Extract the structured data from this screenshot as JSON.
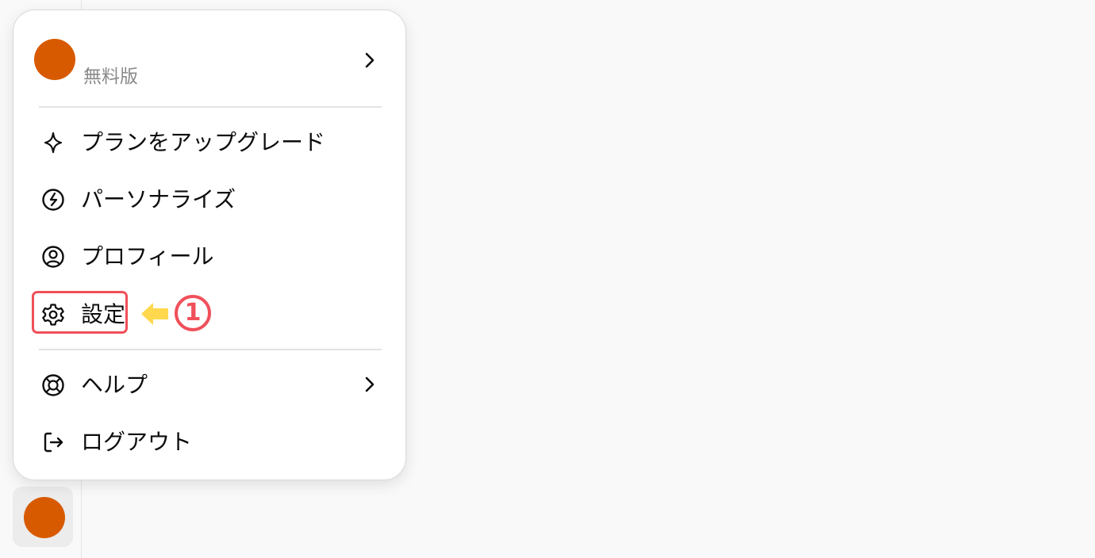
{
  "account": {
    "plan_label": "無料版"
  },
  "menu": {
    "items": [
      {
        "label": "プランをアップグレード",
        "icon": "sparkle-icon"
      },
      {
        "label": "パーソナライズ",
        "icon": "personalize-icon"
      },
      {
        "label": "プロフィール",
        "icon": "profile-icon"
      },
      {
        "label": "設定",
        "icon": "gear-icon"
      },
      {
        "label": "ヘルプ",
        "icon": "lifebuoy-icon"
      },
      {
        "label": "ログアウト",
        "icon": "logout-icon"
      }
    ]
  },
  "annotation": {
    "number": "1"
  },
  "colors": {
    "avatar": "#d85a00",
    "highlight": "#f0505a",
    "arrow": "#ffd84d"
  }
}
